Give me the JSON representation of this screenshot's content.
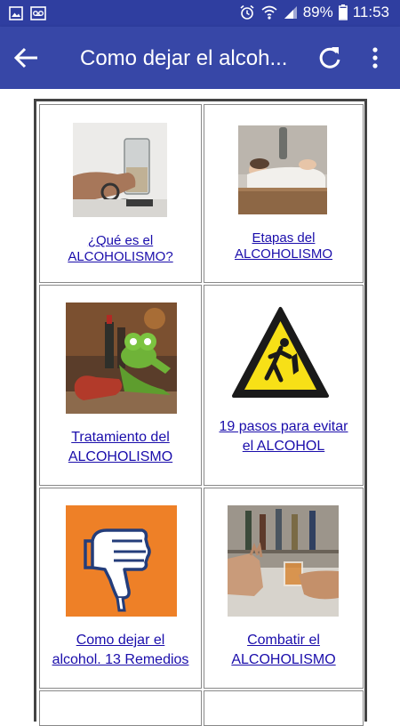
{
  "status_bar": {
    "battery": "89%",
    "time": "11:53"
  },
  "app_bar": {
    "title": "Como dejar el alcoh...",
    "back_icon": "arrow-back-icon",
    "refresh_icon": "refresh-icon",
    "menu_icon": "more-vert-icon"
  },
  "grid": {
    "items": [
      {
        "line1": "¿Qué es el",
        "line2": "ALCOHOLISMO?"
      },
      {
        "line1": "Etapas del",
        "line2": "ALCOHOLISMO"
      },
      {
        "line1": "Tratamiento del",
        "line2": "ALCOHOLISMO"
      },
      {
        "line1": "19 pasos para evitar",
        "line2": "el ALCOHOL"
      },
      {
        "line1": "Como dejar el",
        "line2": "alcohol. 13 Remedios"
      },
      {
        "line1": "Combatir el",
        "line2": "ALCOHOLISMO"
      }
    ]
  }
}
